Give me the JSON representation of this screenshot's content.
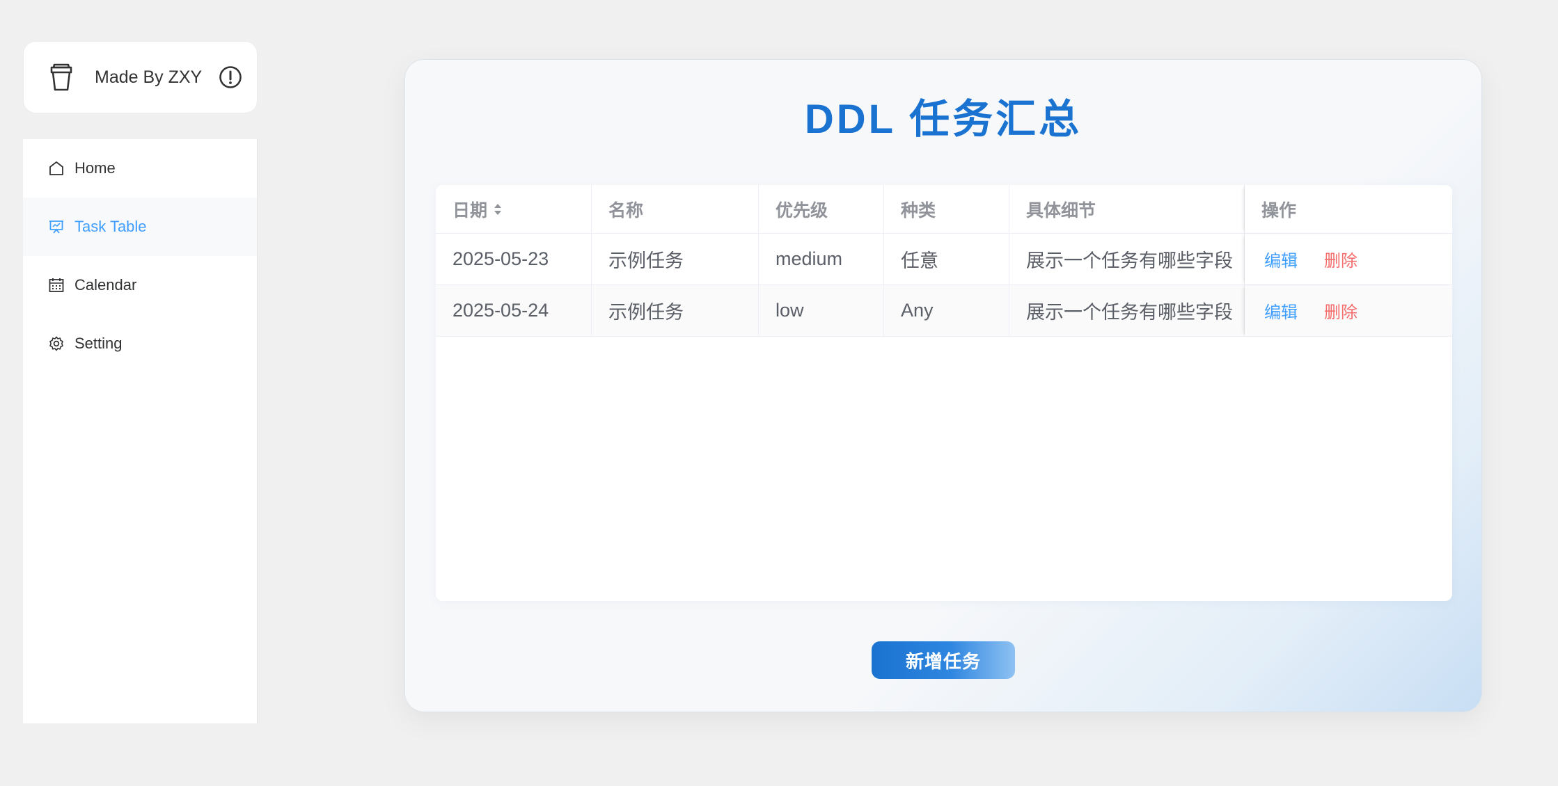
{
  "brand": {
    "text": "Made By ZXY",
    "cup_icon": "cup-icon",
    "info_icon": "info-icon"
  },
  "sidebar": {
    "active_index": 1,
    "items": [
      {
        "label": "Home",
        "icon": "home-icon"
      },
      {
        "label": "Task Table",
        "icon": "presentation-board-icon"
      },
      {
        "label": "Calendar",
        "icon": "calendar-icon"
      },
      {
        "label": "Setting",
        "icon": "gear-icon"
      }
    ]
  },
  "page": {
    "title": "DDL 任务汇总",
    "add_button": "新增任务"
  },
  "table": {
    "columns": [
      "日期",
      "名称",
      "优先级",
      "种类",
      "具体细节",
      "操作"
    ],
    "sortable_column": "日期",
    "rows": [
      {
        "date": "2025-05-23",
        "name": "示例任务",
        "priority": "medium",
        "category": "任意",
        "detail": "展示一个任务有哪些字段"
      },
      {
        "date": "2025-05-24",
        "name": "示例任务",
        "priority": "low",
        "category": "Any",
        "detail": "展示一个任务有哪些字段"
      }
    ],
    "actions": {
      "edit": "编辑",
      "delete": "删除"
    }
  },
  "colors": {
    "accent": "#409eff",
    "title": "#1a73d0",
    "danger": "#f56c6c",
    "header_text": "#909399"
  }
}
